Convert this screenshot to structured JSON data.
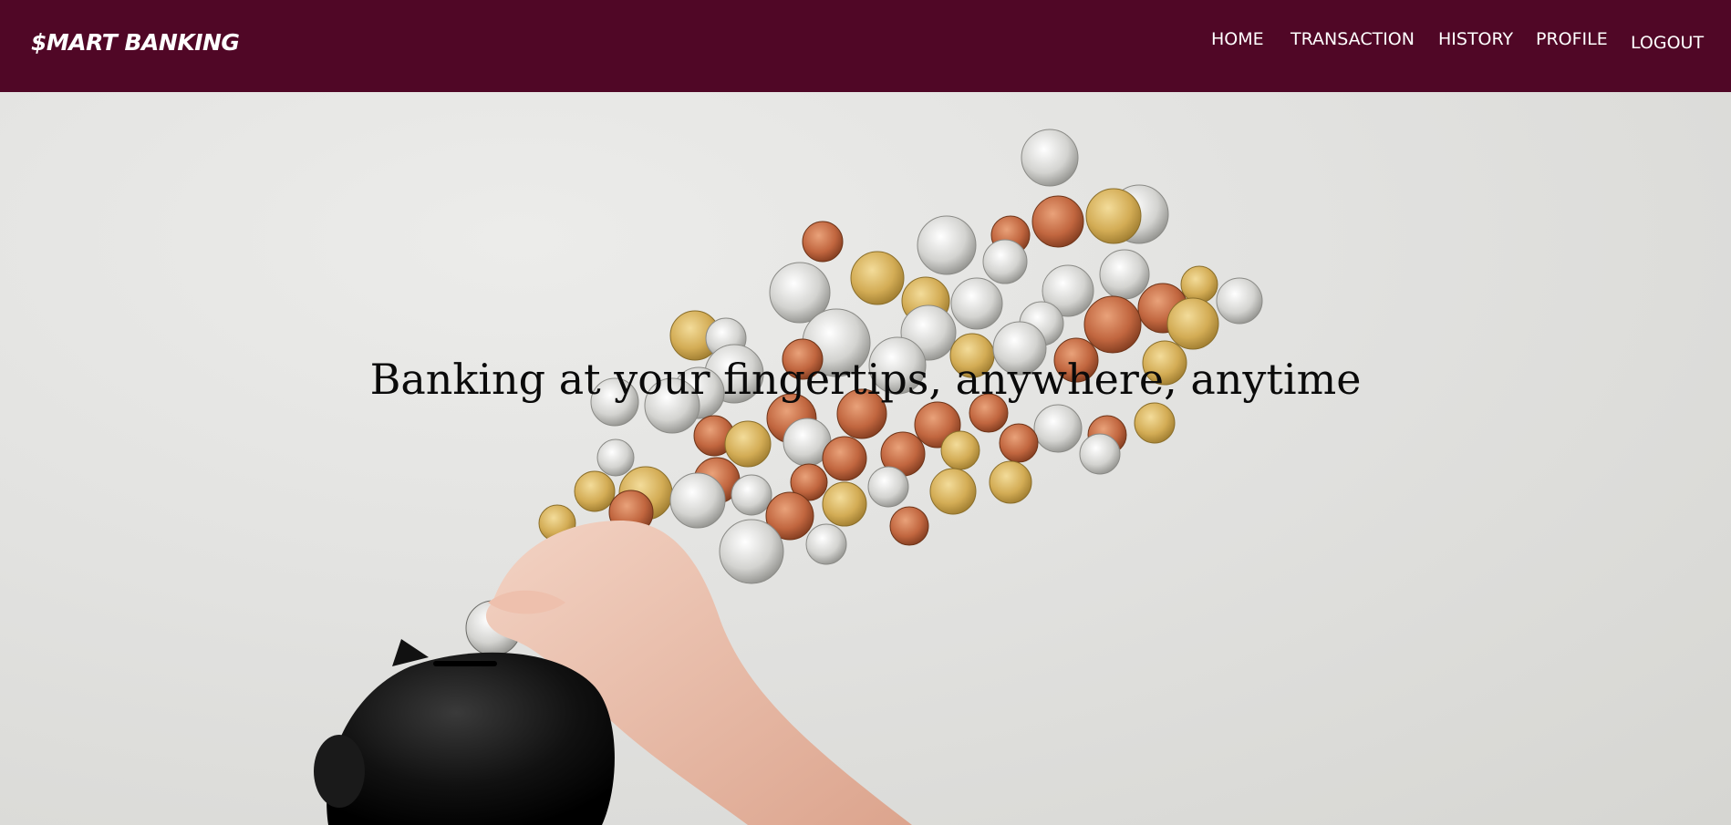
{
  "brand": "$MART BANKING",
  "nav": {
    "home": "HOME",
    "transaction": "TRANSACTION",
    "history": "HISTORY",
    "profile": "PROFILE",
    "logout": "LOGOUT"
  },
  "hero": {
    "headline": "Banking at your fingertips, anywhere, anytime"
  },
  "colors": {
    "navbar": "#500726",
    "nav_text": "#ffffff"
  }
}
